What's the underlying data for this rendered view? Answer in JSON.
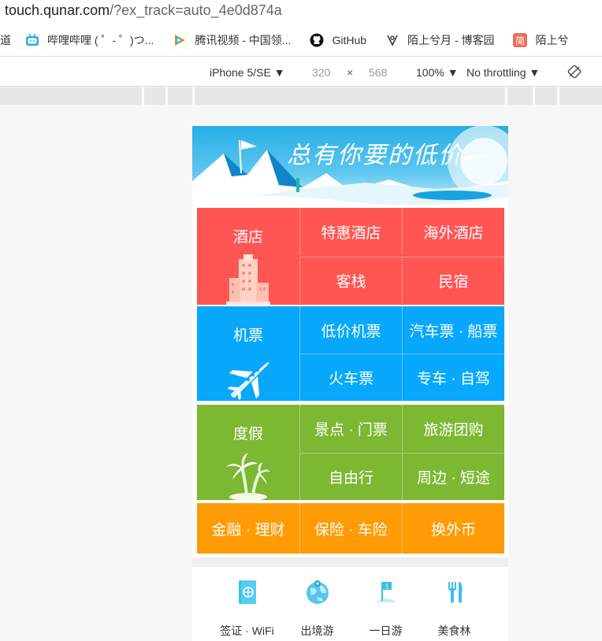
{
  "browser": {
    "url_host": "touch.qunar.com",
    "url_path": "/?ex_track=auto_4e0d874a",
    "bookmarks": [
      {
        "label": "道",
        "icon": "folder-icon"
      },
      {
        "label": "哔哩哔哩 ( ゜- ゜)つ...",
        "icon": "bilibili-icon"
      },
      {
        "label": "腾讯视频 - 中国领...",
        "icon": "tencent-video-icon"
      },
      {
        "label": "GitHub",
        "icon": "github-icon"
      },
      {
        "label": "陌上兮月 - 博客园",
        "icon": "blog-icon"
      },
      {
        "label": "陌上兮",
        "icon": "jianshu-icon"
      }
    ]
  },
  "devtools": {
    "device": "iPhone 5/SE ▼",
    "width": "320",
    "times": "×",
    "height": "568",
    "zoom": "100% ▼",
    "throttling": "No throttling ▼"
  },
  "banner": {
    "slogan": "总有你要的低价"
  },
  "hotel": {
    "main": "酒店",
    "items": [
      "特惠酒店",
      "海外酒店",
      "客栈",
      "民宿"
    ],
    "color": "#ff5653"
  },
  "flight": {
    "main": "机票",
    "items": [
      "低价机票",
      "汽车票 · 船票",
      "火车票",
      "专车 · 自驾"
    ],
    "color": "#08a8fd"
  },
  "vacation": {
    "main": "度假",
    "items": [
      "景点 · 门票",
      "旅游团购",
      "自由行",
      "周边 · 短途"
    ],
    "color": "#7cb832"
  },
  "finance": {
    "items": [
      "金融 · 理财",
      "保险 · 车险",
      "换外币"
    ],
    "color": "#ff9b05"
  },
  "tools": [
    {
      "label": "签证 · WiFi",
      "icon": "passport-icon"
    },
    {
      "label": "出境游",
      "icon": "globe-icon"
    },
    {
      "label": "一日游",
      "icon": "flag-icon"
    },
    {
      "label": "美食林",
      "icon": "fork-knife-icon"
    }
  ]
}
